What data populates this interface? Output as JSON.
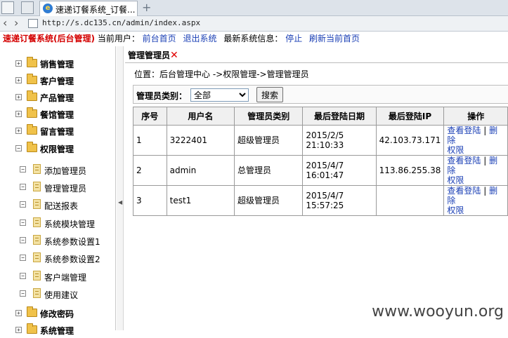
{
  "browser": {
    "tab_title": "速递订餐系统_订餐...",
    "new_tab": "+",
    "url": "http://s.dc135.cn/admin/index.aspx"
  },
  "header": {
    "system_title": "速递订餐系统(后台管理)",
    "current_user_label": "当前用户：",
    "front_home": "前台首页",
    "logout": "退出系统",
    "latest_info_label": "最新系统信息：",
    "stop": "停止",
    "refresh": "刷新当前首页"
  },
  "sidebar": {
    "top": [
      {
        "label": "销售管理"
      },
      {
        "label": "客户管理"
      },
      {
        "label": "产品管理"
      },
      {
        "label": "餐馆管理"
      },
      {
        "label": "留言管理"
      },
      {
        "label": "权限管理"
      }
    ],
    "children": [
      {
        "label": "添加管理员"
      },
      {
        "label": "管理管理员"
      },
      {
        "label": "配送报表"
      },
      {
        "label": "系统模块管理"
      },
      {
        "label": "系统参数设置1"
      },
      {
        "label": "系统参数设置2"
      },
      {
        "label": "客户端管理"
      },
      {
        "label": "使用建议"
      }
    ],
    "bottom": [
      {
        "label": "修改密码"
      },
      {
        "label": "系统管理"
      }
    ]
  },
  "main": {
    "page_tab": "管理管理员",
    "close_icon": "✕",
    "breadcrumb": "位置：后台管理中心 ->权限管理->管理管理员",
    "filter": {
      "label": "管理员类别：",
      "selected": "全部",
      "search_button": "搜索"
    },
    "table": {
      "columns": [
        "序号",
        "用户名",
        "管理员类别",
        "最后登陆日期",
        "最后登陆IP",
        "操作"
      ],
      "rows": [
        {
          "no": "1",
          "user": "3222401",
          "type": "超级管理员",
          "date": "2015/2/5",
          "time": "21:10:33",
          "ip": "42.103.73.171",
          "op1": "查看登陆",
          "sep": "|",
          "op2": "删除",
          "op3": "权限"
        },
        {
          "no": "2",
          "user": "admin",
          "type": "总管理员",
          "date": "2015/4/7",
          "time": "16:01:47",
          "ip": "113.86.255.38",
          "op1": "查看登陆",
          "sep": "|",
          "op2": "删除",
          "op3": "权限"
        },
        {
          "no": "3",
          "user": "test1",
          "type": "超级管理员",
          "date": "2015/4/7",
          "time": "15:57:25",
          "ip": "",
          "op1": "查看登陆",
          "sep": "|",
          "op2": "删除",
          "op3": "权限"
        }
      ]
    }
  },
  "watermark": "www.wooyun.org"
}
